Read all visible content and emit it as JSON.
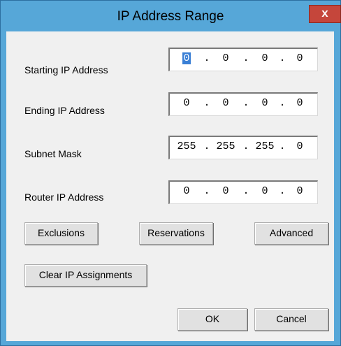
{
  "window": {
    "title": "IP Address Range",
    "close_glyph": "x"
  },
  "fields": [
    {
      "label": "Starting IP Address",
      "octets": [
        "0",
        "0",
        "0",
        "0"
      ]
    },
    {
      "label": "Ending IP Address",
      "octets": [
        "0",
        "0",
        "0",
        "0"
      ]
    },
    {
      "label": "Subnet Mask",
      "octets": [
        "255",
        "255",
        "255",
        "0"
      ]
    },
    {
      "label": "Router IP Address",
      "octets": [
        "0",
        "0",
        "0",
        "0"
      ]
    }
  ],
  "separator": ".",
  "buttons": {
    "exclusions": "Exclusions",
    "reservations": "Reservations",
    "advanced": "Advanced",
    "clear": "Clear IP Assignments",
    "ok": "OK",
    "cancel": "Cancel"
  },
  "colors": {
    "titlebar": "#56a7d8",
    "close": "#c5463b",
    "selection": "#3a7fd5"
  },
  "icons": {
    "close": "close-icon"
  }
}
